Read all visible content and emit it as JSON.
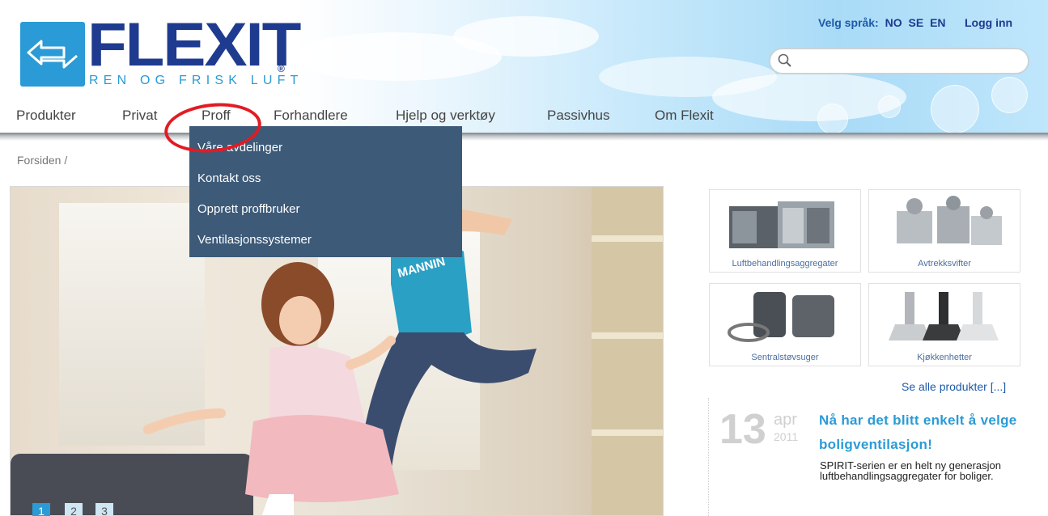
{
  "header": {
    "logo_text": "FLEXIT",
    "logo_reg": "®",
    "logo_tagline": "REN OG FRISK LUFT",
    "language_label": "Velg språk:",
    "languages": [
      "NO",
      "SE",
      "EN"
    ],
    "login_label": "Logg inn",
    "search": {
      "value": "",
      "placeholder": ""
    }
  },
  "nav": {
    "items": [
      {
        "label": "Produkter"
      },
      {
        "label": "Privat"
      },
      {
        "label": "Proff"
      },
      {
        "label": "Forhandlere"
      },
      {
        "label": "Hjelp og verktøy"
      },
      {
        "label": "Passivhus"
      },
      {
        "label": "Om Flexit"
      }
    ],
    "dropdown": {
      "items": [
        {
          "label": "Våre avdelinger"
        },
        {
          "label": "Kontakt oss"
        },
        {
          "label": "Opprett proffbruker"
        },
        {
          "label": "Ventilasjonssystemer"
        }
      ]
    }
  },
  "breadcrumb": {
    "text": "Forsiden /"
  },
  "hero": {
    "shirt_text": "MANNIN",
    "pages": [
      "1",
      "2",
      "3"
    ],
    "active_page": "1"
  },
  "products": {
    "tiles": [
      {
        "label": "Luftbehandlingsaggregater",
        "icon": "air-handling-unit-image"
      },
      {
        "label": "Avtrekksvifter",
        "icon": "exhaust-fan-image"
      },
      {
        "label": "Sentralstøvsuger",
        "icon": "central-vacuum-image"
      },
      {
        "label": "Kjøkkenhetter",
        "icon": "kitchen-hood-image"
      }
    ],
    "see_all": "Se alle produkter [...]"
  },
  "news": {
    "day": "13",
    "month": "apr",
    "year": "2011",
    "title": "Nå har det blitt enkelt å velge boligventilasjon!",
    "body": "SPIRIT-serien er en helt ny generasjon luftbehandlingsaggregater for boliger."
  },
  "colors": {
    "brand_blue": "#2a9bd6",
    "logo_navy": "#1e3b8f",
    "dropdown_bg": "#3d5a78",
    "highlight_red": "#e21b23"
  }
}
